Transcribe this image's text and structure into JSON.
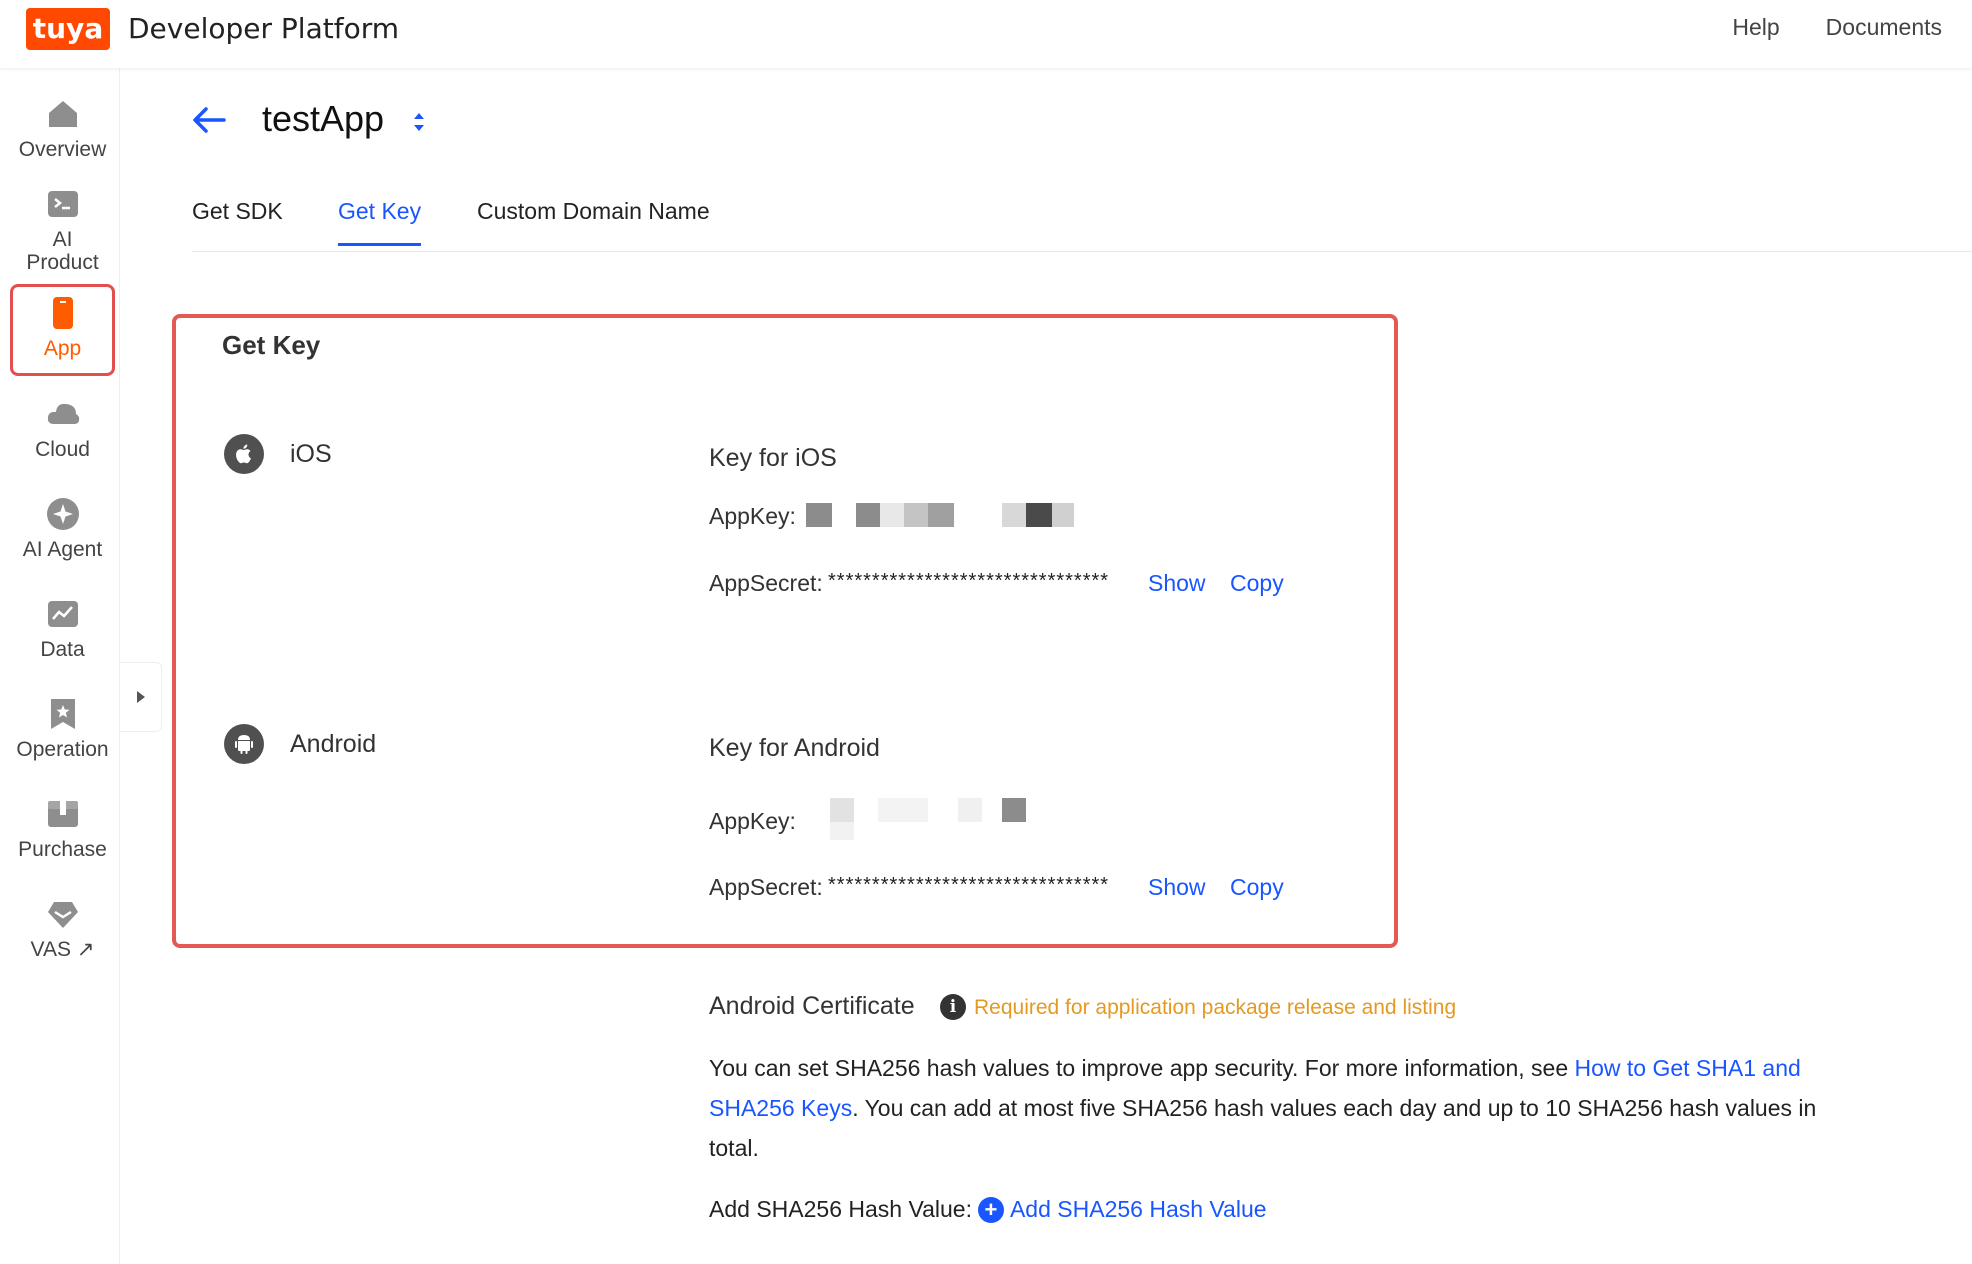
{
  "header": {
    "logo_text": "tuya",
    "brand": "Developer Platform",
    "nav": [
      "Help",
      "Documents"
    ]
  },
  "sidebar": {
    "items": [
      {
        "label": "Overview",
        "icon": "home-icon"
      },
      {
        "label": "AI\nProduct",
        "icon": "terminal-icon"
      },
      {
        "label": "App",
        "icon": "phone-icon",
        "active": true
      },
      {
        "label": "Cloud",
        "icon": "cloud-icon"
      },
      {
        "label": "AI Agent",
        "icon": "sparkle-icon"
      },
      {
        "label": "Data",
        "icon": "chart-icon"
      },
      {
        "label": "Operation",
        "icon": "bookmark-star-icon"
      },
      {
        "label": "Purchase",
        "icon": "box-icon"
      },
      {
        "label": "VAS",
        "icon": "gem-icon",
        "suffix": "↗"
      }
    ]
  },
  "page": {
    "app_name": "testApp",
    "tabs": [
      "Get SDK",
      "Get Key",
      "Custom Domain Name"
    ],
    "active_tab": "Get Key"
  },
  "get_key": {
    "title": "Get Key",
    "ios": {
      "platform": "iOS",
      "heading": "Key for iOS",
      "appkey_label": "AppKey:",
      "appsecret_label": "AppSecret:",
      "appsecret_mask": "********************************",
      "show": "Show",
      "copy": "Copy"
    },
    "android": {
      "platform": "Android",
      "heading": "Key for Android",
      "appkey_label": "AppKey:",
      "appsecret_label": "AppSecret:",
      "appsecret_mask": "********************************",
      "show": "Show",
      "copy": "Copy"
    }
  },
  "android_certificate": {
    "title": "Android Certificate",
    "required_note": "Required for application package release and listing",
    "desc_prefix": "You can set SHA256 hash values to improve app security. For more information, see ",
    "desc_link": "How to Get SHA1 and SHA256 Keys",
    "desc_suffix": ". You can add at most five SHA256 hash values each day and up to 10 SHA256 hash values in total.",
    "add_label": "Add SHA256 Hash Value:",
    "add_link": "Add SHA256 Hash Value"
  },
  "colors": {
    "brand_orange": "#ff4800",
    "link_blue": "#1a56ff",
    "highlight_red": "#e35a55",
    "warning_orange": "#e49a22"
  }
}
